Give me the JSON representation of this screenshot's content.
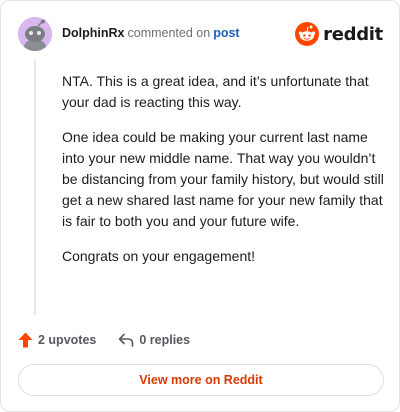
{
  "header": {
    "username": "DolphinRx",
    "action_text": "commented on",
    "post_link": "post",
    "logo_text": "reddit"
  },
  "comment": {
    "paragraphs": [
      "NTA. This is a great idea, and it’s unfortunate that your dad is reacting this way.",
      "One idea could be making your current last name into your new middle name. That way you wouldn’t be distancing from your family history, but would still get a new shared last name for your new family that is fair to both you and your future wife.",
      "Congrats on your engagement!"
    ]
  },
  "actions": {
    "upvotes": "2 upvotes",
    "replies": "0 replies"
  },
  "footer": {
    "view_more": "View more on Reddit"
  },
  "colors": {
    "brand_orange": "#ff4500",
    "link_blue": "#1f5fb7",
    "view_more_text": "#d93a00",
    "avatar_bg": "#d8b8ee"
  },
  "icons": {
    "avatar": "snoo-avatar-icon",
    "logo": "reddit-snoo-icon",
    "upvote": "upvote-arrow-icon",
    "reply": "reply-arrow-icon"
  }
}
